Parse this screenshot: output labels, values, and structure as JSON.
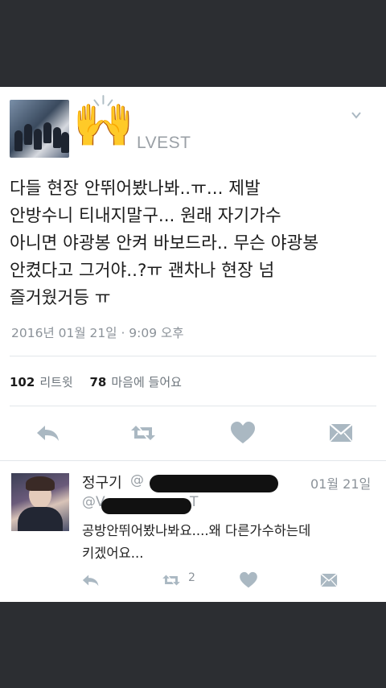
{
  "original_tweet": {
    "author_handle_visible": "LVEST",
    "author_handle_prefix": "@",
    "text_lines": [
      "다들 현장 안뛰어봤나봐..ㅠ... 제발",
      "안방수니 티내지말구... 원래 자기가수",
      "아니면 야광봉 안켜 바보드라.. 무슨 야광봉",
      "안켰다고 그거야..?ㅠ 괜차나 현장 넘",
      "즐거웠거등 ㅠ"
    ],
    "timestamp": "2016년 01월 21일 · 9:09 오후",
    "retweet_count": "102",
    "retweet_label": "리트윗",
    "like_count": "78",
    "like_label": "마음에 들어요"
  },
  "reply": {
    "name": "정구기",
    "at_prefix": "@",
    "reply_to_prefix": "@V",
    "reply_to_suffix": "T",
    "date": "01월 21일",
    "text_lines": [
      "공방안뛰어봤나봐요....왜 다른가수하는데",
      "키겠어요..."
    ],
    "retweet_count": "2"
  },
  "icons": {
    "author_avatar": "group-photo",
    "emoji_overlay": "raised-hands-emoji",
    "menu": "chevron-down-icon",
    "reply": "reply-icon",
    "retweet": "retweet-icon",
    "like": "heart-icon",
    "message": "envelope-icon"
  },
  "colors": {
    "background": "#2c2e32",
    "card": "#ffffff",
    "icon_gray": "#aab8c2",
    "text": "#1c1c1c",
    "muted": "#8b9299"
  }
}
